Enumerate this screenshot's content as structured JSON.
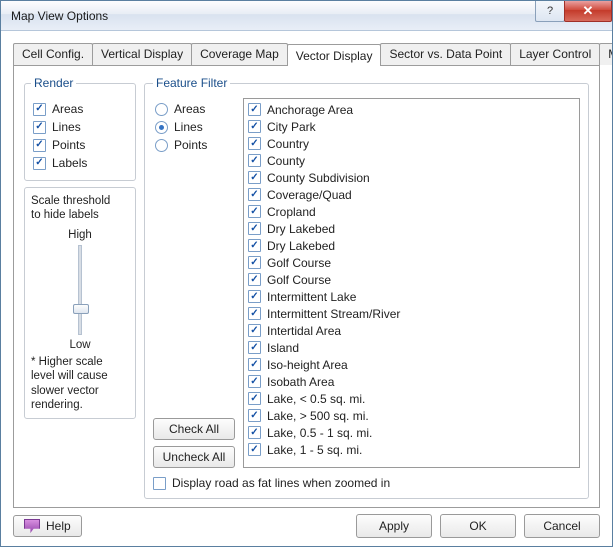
{
  "window": {
    "title": "Map View Options"
  },
  "tabs": [
    {
      "label": "Cell Config."
    },
    {
      "label": "Vertical Display"
    },
    {
      "label": "Coverage Map"
    },
    {
      "label": "Vector Display",
      "active": true
    },
    {
      "label": "Sector vs. Data Point"
    },
    {
      "label": "Layer Control"
    },
    {
      "label": "Misc."
    }
  ],
  "render": {
    "legend": "Render",
    "items": [
      {
        "label": "Areas",
        "checked": true
      },
      {
        "label": "Lines",
        "checked": true
      },
      {
        "label": "Points",
        "checked": true
      },
      {
        "label": "Labels",
        "checked": true
      }
    ]
  },
  "scale": {
    "heading1": "Scale threshold",
    "heading2": "to hide labels",
    "high": "High",
    "low": "Low",
    "note": "* Higher scale level will cause slower vector rendering."
  },
  "filter": {
    "legend": "Feature Filter",
    "radios": [
      {
        "label": "Areas",
        "selected": false
      },
      {
        "label": "Lines",
        "selected": true
      },
      {
        "label": "Points",
        "selected": false
      }
    ],
    "check_all": "Check All",
    "uncheck_all": "Uncheck All",
    "items": [
      "Anchorage Area",
      "City Park",
      "Country",
      "County",
      "County Subdivision",
      "Coverage/Quad",
      "Cropland",
      "Dry Lakebed",
      "Dry Lakebed",
      "Golf Course",
      "Golf Course",
      "Intermittent Lake",
      "Intermittent Stream/River",
      "Intertidal Area",
      "Island",
      "Iso-height Area",
      "Isobath Area",
      "Lake, < 0.5 sq. mi.",
      "Lake, > 500 sq. mi.",
      "Lake, 0.5 - 1 sq. mi.",
      "Lake, 1 - 5 sq. mi."
    ]
  },
  "bottom": {
    "display_road": "Display road as fat lines when zoomed in",
    "checked": false
  },
  "buttons": {
    "help": "Help",
    "apply": "Apply",
    "ok": "OK",
    "cancel": "Cancel"
  }
}
